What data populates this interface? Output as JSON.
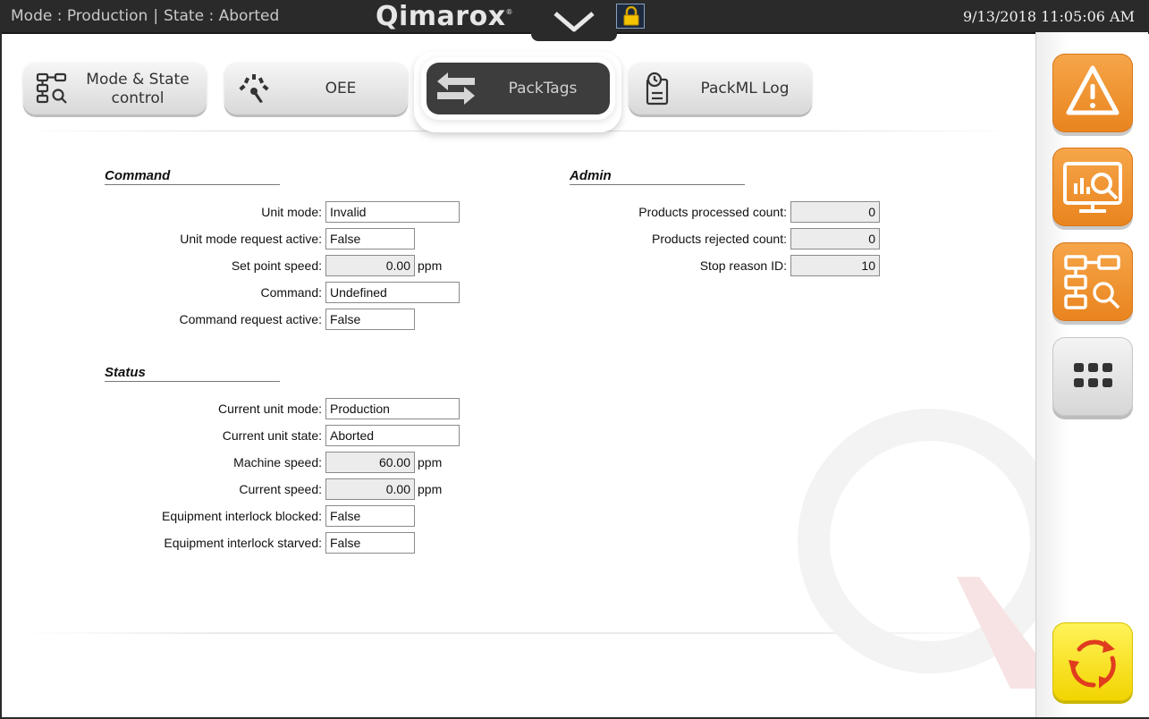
{
  "header": {
    "mode_label": "Mode : Production",
    "separator": "|",
    "state_label": "State : Aborted",
    "logo_text": "Qimarox",
    "logo_mark": "®",
    "datetime": "9/13/2018 11:05:06 AM",
    "dropdown_icon": "chevron-down-icon",
    "lock_icon": "lock-icon"
  },
  "tabs": [
    {
      "label_line1": "Mode & State",
      "label_line2": "control",
      "icon": "state-diagram-icon",
      "active": false
    },
    {
      "label": "OEE",
      "icon": "gauge-icon",
      "active": false
    },
    {
      "label": "PackTags",
      "icon": "transfer-arrows-icon",
      "active": true
    },
    {
      "label": "PackML Log",
      "icon": "log-clock-icon",
      "active": false
    }
  ],
  "command": {
    "title": "Command",
    "unit_mode": {
      "label": "Unit mode:",
      "value": "Invalid"
    },
    "unit_mode_request_active": {
      "label": "Unit mode request active:",
      "value": "False"
    },
    "set_point_speed": {
      "label": "Set point speed:",
      "value": "0.00",
      "unit": "ppm"
    },
    "command": {
      "label": "Command:",
      "value": "Undefined"
    },
    "command_request_active": {
      "label": "Command request active:",
      "value": "False"
    }
  },
  "status": {
    "title": "Status",
    "current_unit_mode": {
      "label": "Current unit mode:",
      "value": "Production"
    },
    "current_unit_state": {
      "label": "Current unit state:",
      "value": "Aborted"
    },
    "machine_speed": {
      "label": "Machine speed:",
      "value": "60.00",
      "unit": "ppm"
    },
    "current_speed": {
      "label": "Current speed:",
      "value": "0.00",
      "unit": "ppm"
    },
    "equipment_interlock_blocked": {
      "label": "Equipment interlock blocked:",
      "value": "False"
    },
    "equipment_interlock_starved": {
      "label": "Equipment interlock starved:",
      "value": "False"
    }
  },
  "admin": {
    "title": "Admin",
    "products_processed_count": {
      "label": "Products processed count:",
      "value": "0"
    },
    "products_rejected_count": {
      "label": "Products rejected count:",
      "value": "0"
    },
    "stop_reason_id": {
      "label": "Stop reason ID:",
      "value": "10"
    }
  },
  "sidebar": {
    "buttons": [
      {
        "icon": "warning-icon",
        "color": "#ee8f2a"
      },
      {
        "icon": "report-monitor-icon",
        "color": "#ee8f2a"
      },
      {
        "icon": "state-diagram-icon",
        "color": "#ee8f2a"
      },
      {
        "icon": "menu-dots-icon",
        "color": "#e0e0e0"
      },
      {
        "icon": "reset-cycle-icon",
        "color": "#f8e61c"
      }
    ]
  },
  "colors": {
    "accent_orange": "#ee8f2a",
    "reset_yellow": "#f8e61c",
    "reset_arrows": "#e03c1e",
    "header_bg": "#2a2a2a"
  }
}
